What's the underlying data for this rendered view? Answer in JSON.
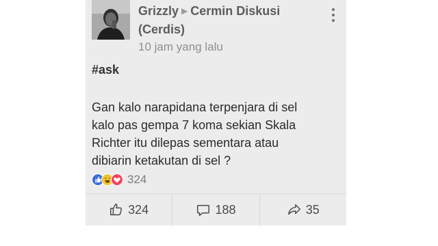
{
  "post": {
    "author": "Grizzly",
    "group_line1": "Cermin Diskusi",
    "group_line2": "(Cerdis)",
    "time": "10 jam yang lalu",
    "hashtag": "#ask",
    "body_lines": [
      "Gan kalo narapidana terpenjara di sel",
      "kalo pas gempa 7 koma sekian Skala",
      "Richter itu dilepas sementara atau",
      "dibiarin ketakutan di sel ?"
    ],
    "reaction_icons": [
      "like-reaction-icon",
      "haha-reaction-icon",
      "love-reaction-icon"
    ],
    "reaction_count": "324"
  },
  "actions": {
    "like_count": "324",
    "comment_count": "188",
    "share_count": "35"
  },
  "colors": {
    "card_bg": "#ececec",
    "like_blue": "#3b6fd8",
    "haha_yellow": "#f2c230",
    "love_red": "#f0455c"
  }
}
